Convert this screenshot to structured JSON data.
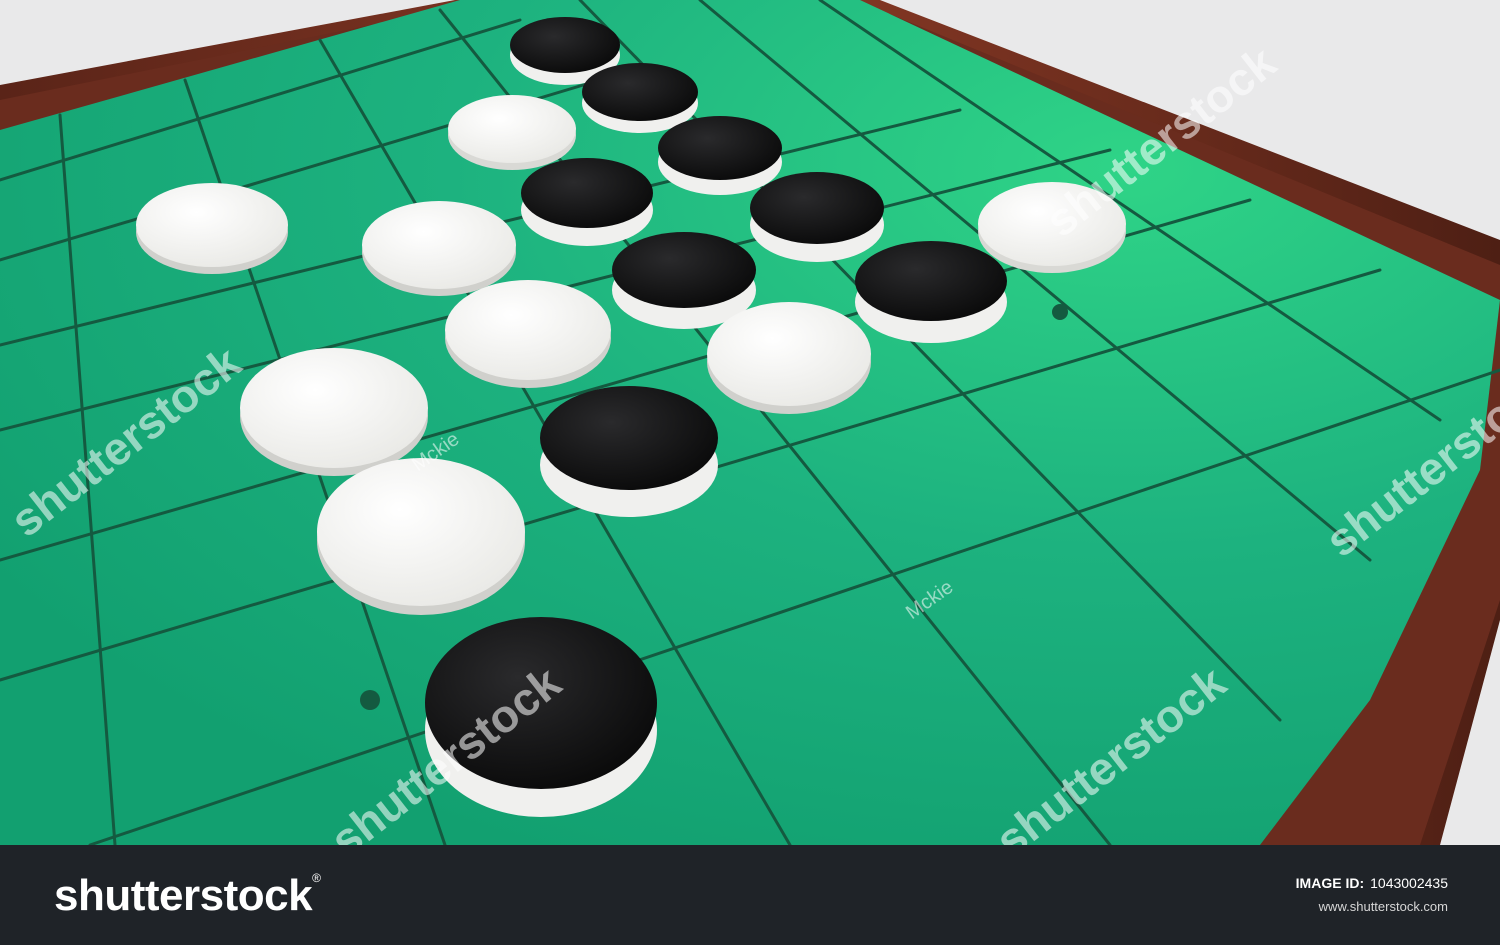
{
  "watermark": {
    "brand": "shutterstock",
    "contributor": "Mckie"
  },
  "footer": {
    "logo": "shutterstock",
    "logo_mark": "®",
    "image_id_label": "IMAGE ID:",
    "image_id": "1043002435",
    "url": "www.shutterstock.com"
  },
  "scene": {
    "subject": "othello-board",
    "board_color": "#1db27f",
    "grid_line_color": "#145a40",
    "frame_color": "#6a2c1e",
    "background_color": "#e9e9ea",
    "black_disc_color": "#111111",
    "white_disc_color": "#f4f4f2"
  }
}
